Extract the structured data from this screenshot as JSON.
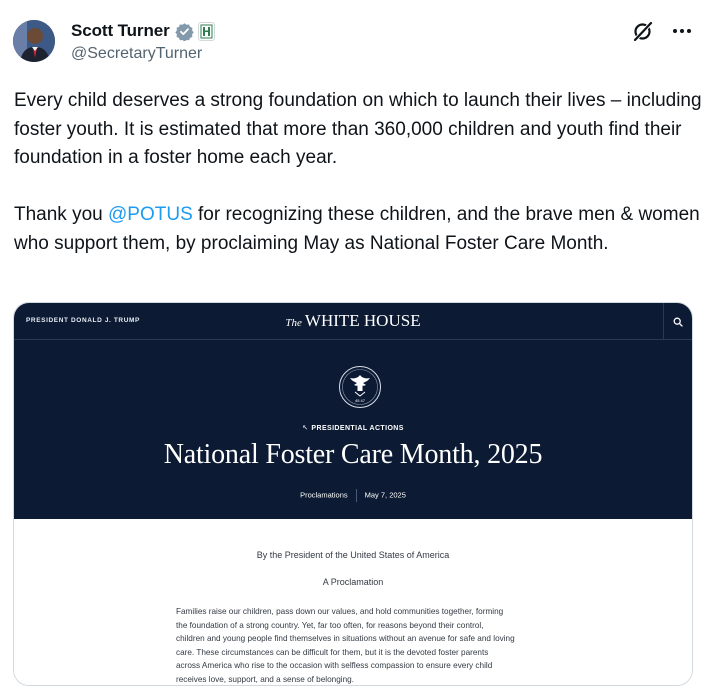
{
  "author": {
    "display_name": "Scott Turner",
    "handle": "@SecretaryTurner",
    "verified_icon": "verified-badge-icon",
    "affiliation_icon": "hud-affiliation-icon"
  },
  "actions": {
    "grok_icon": "grok-icon",
    "more_icon": "more-options-icon"
  },
  "tweet": {
    "para1": "Every child deserves a strong foundation on which to launch their lives – including foster youth. It is estimated that more than 360,000 children and youth find their foundation in a foster home each year.",
    "para2_before": "Thank you ",
    "para2_mention": "@POTUS",
    "para2_after": " for recognizing these children, and the brave men & women who support them, by proclaiming May as National Foster Care Month."
  },
  "media": {
    "president_label": "PRESIDENT DONALD J. TRUMP",
    "logo_the": "The",
    "logo_main": "WHITE HOUSE",
    "seal_text": "45 47",
    "kicker": "PRESIDENTIAL ACTIONS",
    "title": "National Foster Care Month, 2025",
    "category": "Proclamations",
    "date": "May 7, 2025",
    "by_line": "By the President of the United States of America",
    "proclamation": "A Proclamation",
    "body_lines": [
      "Families raise our children, pass down our values, and hold communities together, forming",
      "the foundation of a strong country.  Yet, far too often, for reasons beyond their control,",
      "children and young people find themselves in situations without an avenue for safe and loving",
      "care.  These circumstances can be difficult for them, but it is the devoted foster parents",
      "across America who rise to the occasion with selfless compassion to ensure every child",
      "receives love, support, and a sense of belonging."
    ]
  },
  "colors": {
    "mention": "#1d9bf0",
    "verified": "#829aab",
    "wh_navy": "#0c1a33"
  }
}
